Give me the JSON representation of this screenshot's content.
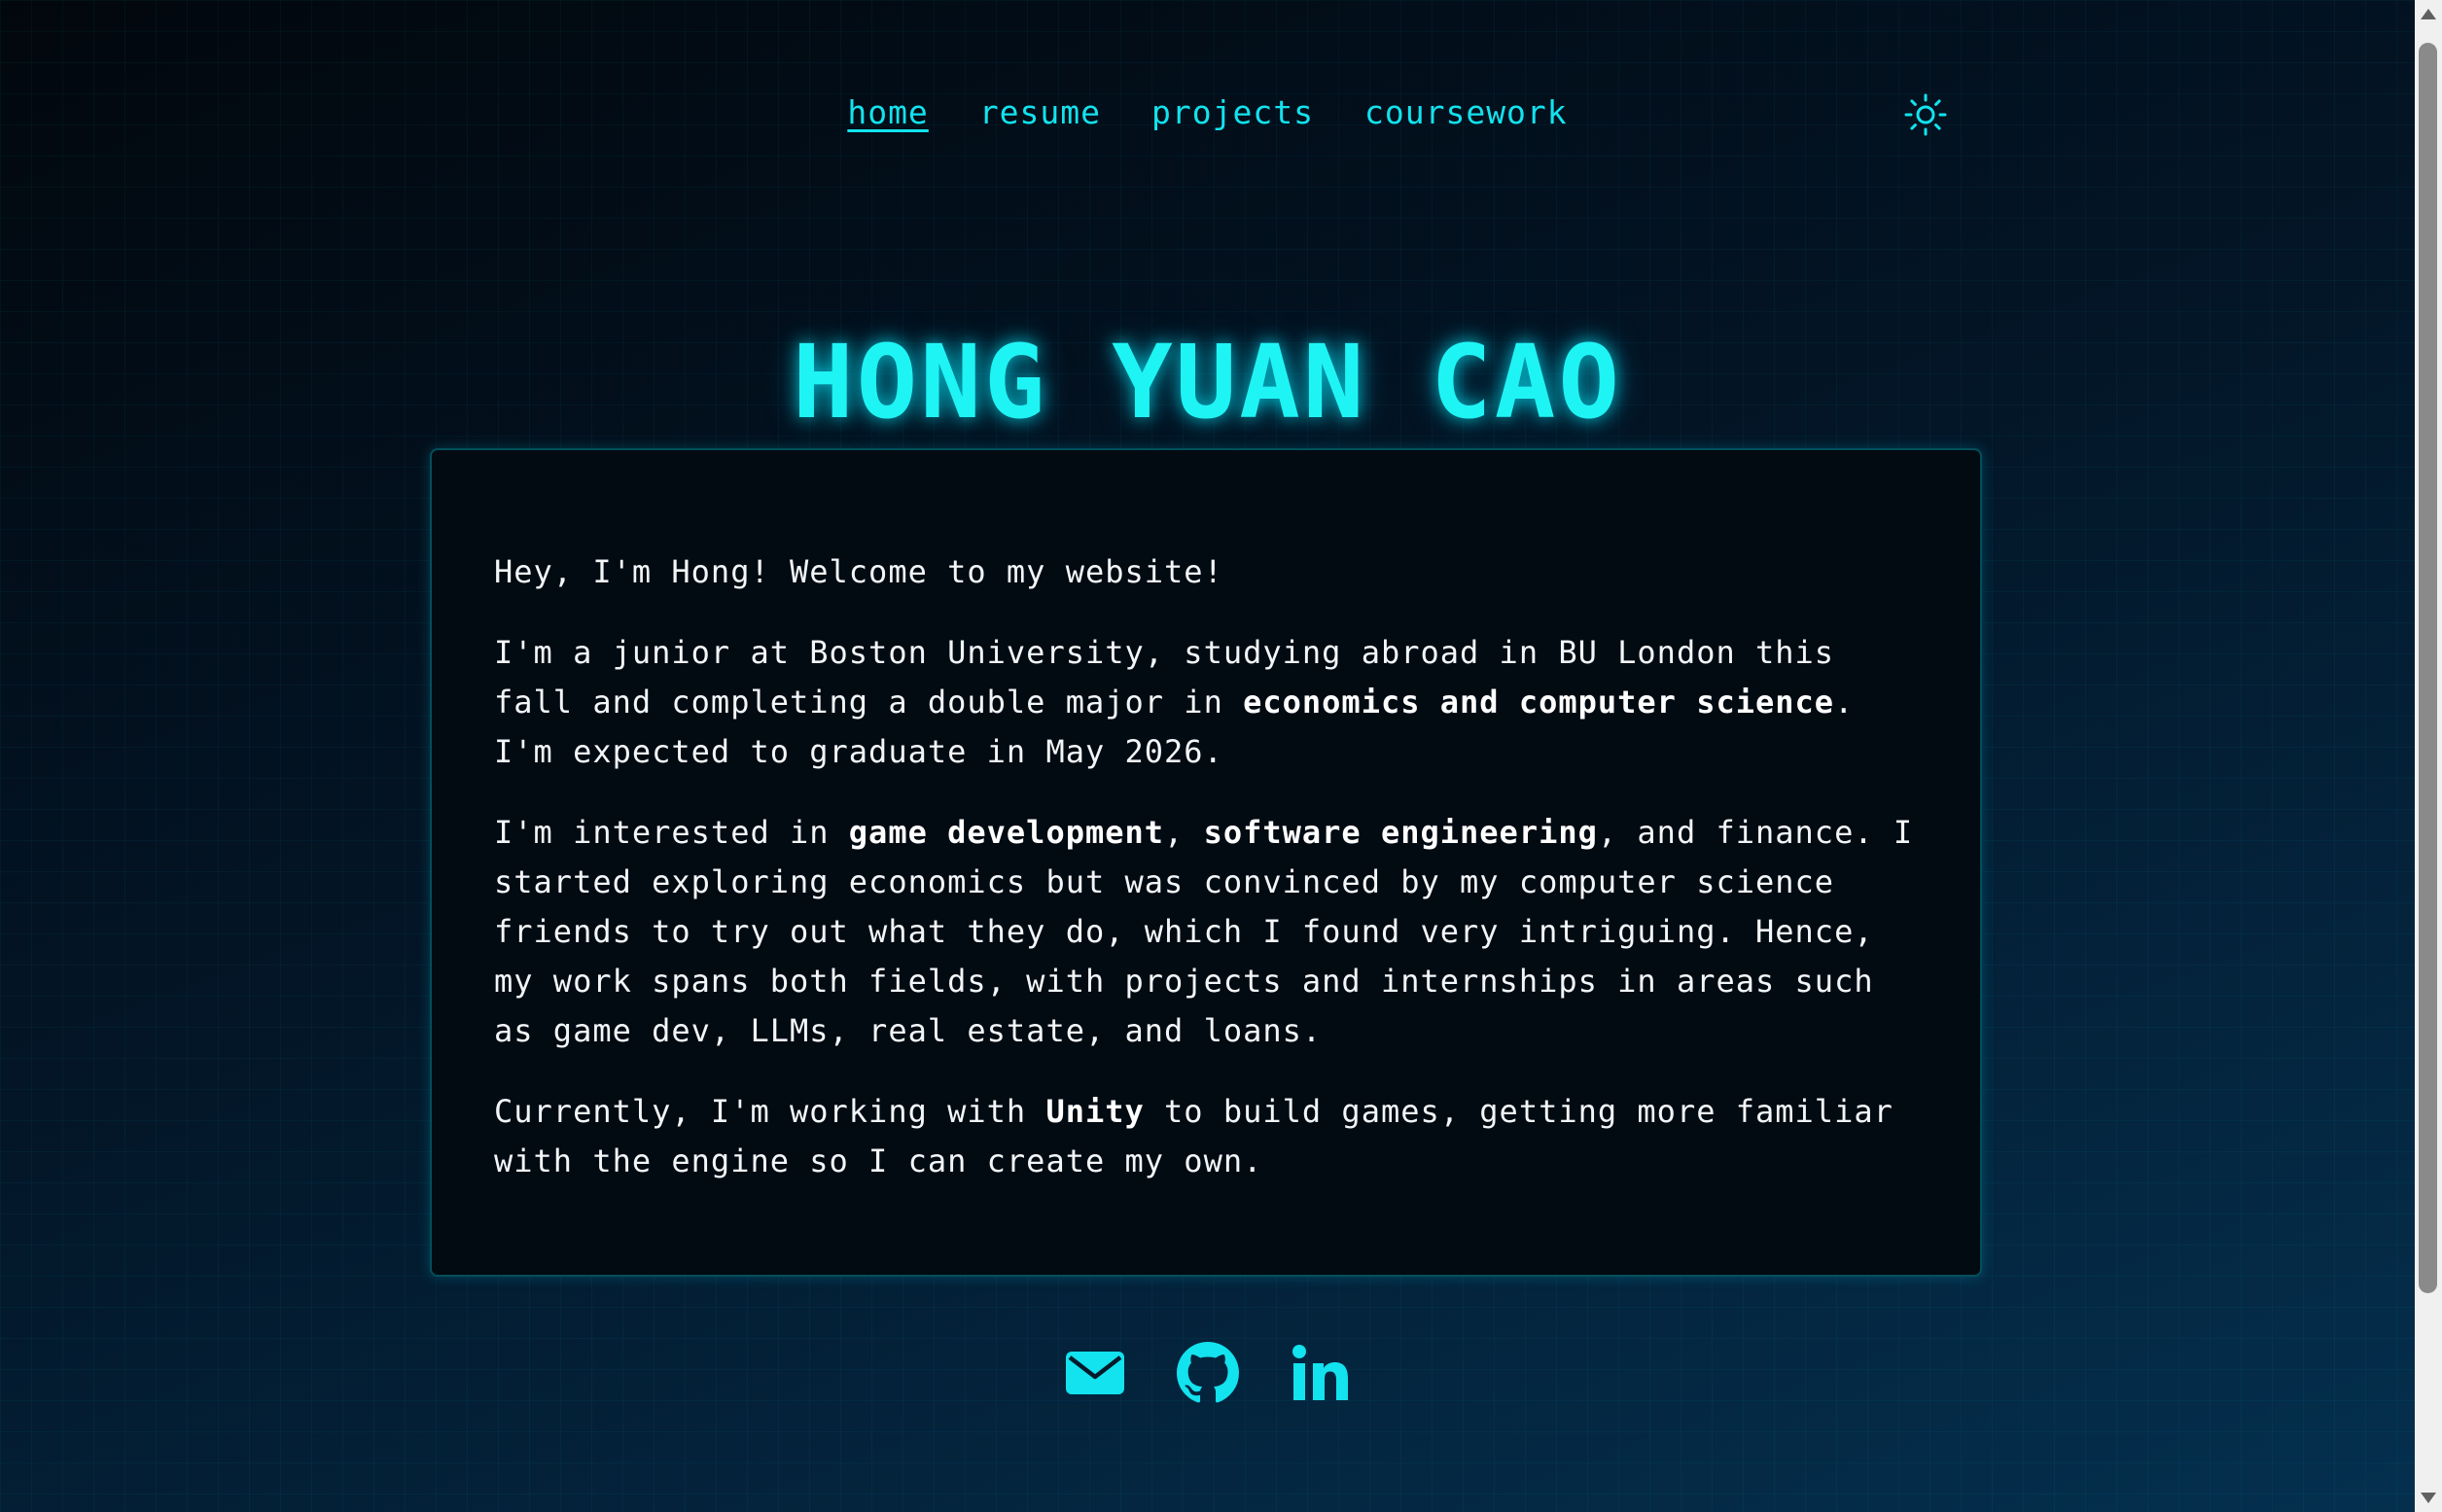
{
  "nav": {
    "items": [
      {
        "label": "home",
        "active": true
      },
      {
        "label": "resume",
        "active": false
      },
      {
        "label": "projects",
        "active": false
      },
      {
        "label": "coursework",
        "active": false
      }
    ],
    "theme_toggle_icon": "sun-icon"
  },
  "header": {
    "title": "HONG YUAN CAO"
  },
  "about": {
    "p1": "Hey, I'm Hong! Welcome to my website!",
    "p2": {
      "a": "I'm a junior at Boston University, studying abroad in BU London this fall and completing a double major in ",
      "b": "economics and computer science",
      "c": ". I'm expected to graduate in May 2026."
    },
    "p3": {
      "a": "I'm interested in ",
      "b": "game development",
      "c": ", ",
      "d": "software engineering",
      "e": ", and finance. I started exploring economics but was convinced by my computer science friends to try out what they do, which I found very intriguing. Hence, my work spans both fields, with projects and internships in areas such as game dev, LLMs, real estate, and loans."
    },
    "p4": {
      "a": "Currently, I'm working with ",
      "b": "Unity",
      "c": " to build games, getting more familiar with the engine so I can create my own."
    }
  },
  "social": {
    "icons": [
      "email-icon",
      "github-icon",
      "linkedin-icon"
    ]
  },
  "colors": {
    "accent": "#12e3ee",
    "background": "#020a14",
    "card_background": "#020a12",
    "text": "#f2f6f8"
  }
}
